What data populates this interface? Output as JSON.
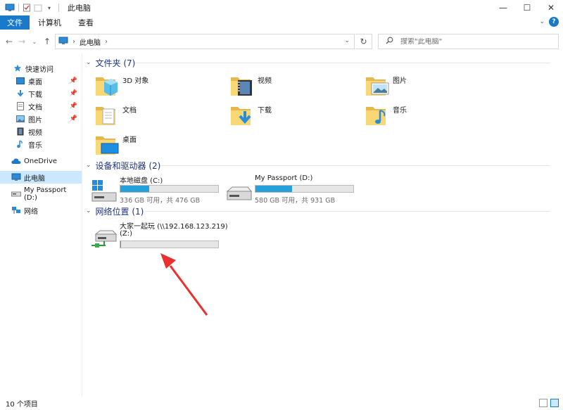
{
  "window": {
    "title": "此电脑",
    "quick_access_icons": [
      "computer-icon",
      "properties-icon",
      "new-folder-icon",
      "customize-dropdown-icon"
    ],
    "controls": [
      "minimize",
      "maximize",
      "close"
    ]
  },
  "ribbon": {
    "tabs": [
      "文件",
      "计算机",
      "查看"
    ]
  },
  "navigation": {
    "breadcrumb": [
      "此电脑"
    ],
    "search_placeholder": "搜索\"此电脑\""
  },
  "sidebar": {
    "items": [
      {
        "label": "快速访问",
        "icon": "star-icon",
        "pinned": false
      },
      {
        "label": "桌面",
        "icon": "desktop-icon",
        "pinned": true
      },
      {
        "label": "下载",
        "icon": "download-icon",
        "pinned": true
      },
      {
        "label": "文档",
        "icon": "document-icon",
        "pinned": true
      },
      {
        "label": "图片",
        "icon": "picture-icon",
        "pinned": true
      },
      {
        "label": "视频",
        "icon": "video-icon",
        "pinned": false
      },
      {
        "label": "音乐",
        "icon": "music-icon",
        "pinned": false
      },
      {
        "label": "OneDrive",
        "icon": "cloud-icon",
        "pinned": false
      },
      {
        "label": "此电脑",
        "icon": "computer-icon",
        "pinned": false,
        "selected": true
      },
      {
        "label": "My Passport (D:)",
        "icon": "drive-icon",
        "pinned": false
      },
      {
        "label": "网络",
        "icon": "network-icon",
        "pinned": false
      }
    ]
  },
  "content": {
    "folders_header": "文件夹 (7)",
    "folders": [
      {
        "name": "3D 对象",
        "icon": "3d-objects-folder-icon"
      },
      {
        "name": "视频",
        "icon": "videos-folder-icon"
      },
      {
        "name": "图片",
        "icon": "pictures-folder-icon"
      },
      {
        "name": "文档",
        "icon": "documents-folder-icon"
      },
      {
        "name": "下载",
        "icon": "downloads-folder-icon"
      },
      {
        "name": "音乐",
        "icon": "music-folder-icon"
      },
      {
        "name": "桌面",
        "icon": "desktop-folder-icon"
      }
    ],
    "devices_header": "设备和驱动器 (2)",
    "devices": [
      {
        "name": "本地磁盘 (C:)",
        "free_text": "336 GB 可用，共 476 GB",
        "used_fraction": 0.294,
        "icon": "windows-drive-icon"
      },
      {
        "name": "My Passport (D:)",
        "free_text": "580 GB 可用，共 931 GB",
        "used_fraction": 0.377,
        "icon": "external-drive-icon"
      }
    ],
    "network_header": "网络位置 (1)",
    "network": [
      {
        "name": "大家一起玩 (\\\\192.168.123.219)",
        "name_line2": "(Z:)",
        "used_fraction": 0.01,
        "icon": "network-drive-icon"
      }
    ]
  },
  "status": {
    "item_count": "10 个项目"
  },
  "colors": {
    "accent": "#1979ca",
    "bar_fill": "#26a0da",
    "selection": "#cce8ff",
    "header_text": "#1e3287",
    "annotation_arrow": "#e8312f"
  }
}
